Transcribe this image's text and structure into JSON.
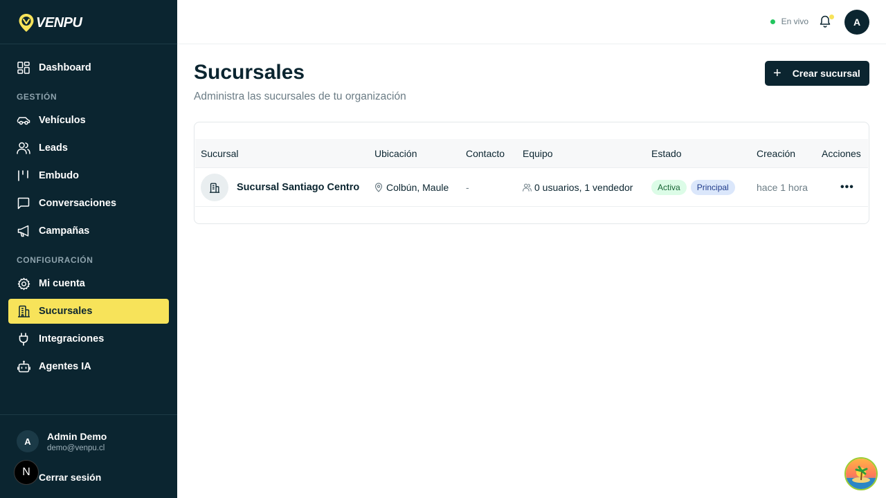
{
  "brand": {
    "name": "VENPU",
    "accent": "#f7e35a",
    "dark": "#0b2530"
  },
  "sidebar": {
    "dashboard": {
      "label": "Dashboard",
      "icon": "dashboard-icon"
    },
    "sections": [
      {
        "title": "GESTIÓN",
        "items": [
          {
            "label": "Vehículos",
            "icon": "car-icon"
          },
          {
            "label": "Leads",
            "icon": "users-icon"
          },
          {
            "label": "Embudo",
            "icon": "funnel-icon"
          },
          {
            "label": "Conversaciones",
            "icon": "chat-icon"
          },
          {
            "label": "Campañas",
            "icon": "megaphone-icon"
          }
        ]
      },
      {
        "title": "CONFIGURACIÓN",
        "items": [
          {
            "label": "Mi cuenta",
            "icon": "gear-icon"
          },
          {
            "label": "Sucursales",
            "icon": "building-icon",
            "active": true
          },
          {
            "label": "Integraciones",
            "icon": "plug-icon"
          },
          {
            "label": "Agentes IA",
            "icon": "bot-icon"
          }
        ]
      }
    ],
    "user": {
      "initial": "A",
      "name": "Admin Demo",
      "email": "demo@venpu.cl"
    },
    "logout_label": "Cerrar sesión",
    "n_badge": "N"
  },
  "topbar": {
    "live_label": "En vivo",
    "avatar_initial": "A"
  },
  "page": {
    "title": "Sucursales",
    "subtitle": "Administra las sucursales de tu organización",
    "create_label": "Crear sucursal"
  },
  "table": {
    "headers": [
      "Sucursal",
      "Ubicación",
      "Contacto",
      "Equipo",
      "Estado",
      "Creación",
      "Acciones"
    ],
    "rows": [
      {
        "name": "Sucursal Santiago Centro",
        "location": "Colbún, Maule",
        "contact": "-",
        "team": "0 usuarios, 1 vendedor",
        "status": "Activa",
        "tag": "Principal",
        "created": "hace 1 hora",
        "actions": "•••"
      }
    ]
  }
}
